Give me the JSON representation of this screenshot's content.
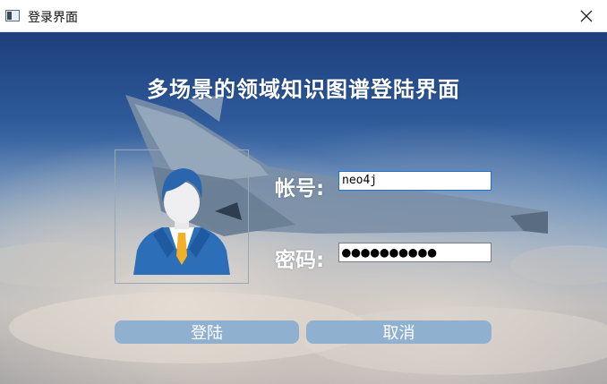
{
  "window": {
    "title": "登录界面"
  },
  "heading": "多场景的领域知识图谱登陆界面",
  "form": {
    "account_label": "帐号:",
    "account_value": "neo4j",
    "password_label": "密码:",
    "password_mask": "●●●●●●●●●●"
  },
  "buttons": {
    "login": "登陆",
    "cancel": "取消"
  },
  "icons": {
    "app": "window-app-icon",
    "close": "close-icon",
    "avatar": "user-avatar-icon"
  },
  "colors": {
    "button_bg": "#8fb0cf",
    "field_focus_border": "#1c6fd4",
    "sky_top": "#1d3f7c"
  }
}
